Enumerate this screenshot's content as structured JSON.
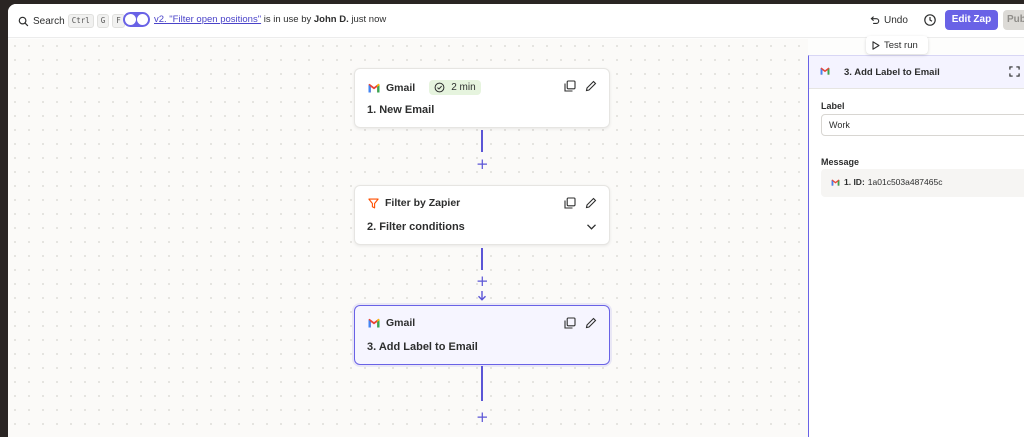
{
  "topbar": {
    "search_label": "Search",
    "shortcut_keys": [
      "Ctrl",
      "G",
      "F"
    ],
    "version_link": "v2. \"Filter open positions\"",
    "notice_middle": " is in use by ",
    "notice_user": "John D.",
    "notice_tail": " just now",
    "undo_label": "Undo",
    "edit_zap_label": "Edit Zap",
    "publish_label": "Pub",
    "test_run_label": "Test run"
  },
  "steps": [
    {
      "app": "Gmail",
      "badge": "2 min",
      "title": "1. New Email"
    },
    {
      "app": "Filter by Zapier",
      "title": "2. Filter conditions"
    },
    {
      "app": "Gmail",
      "title": "3. Add Label to Email"
    }
  ],
  "panel": {
    "title": "3. Add Label to Email",
    "label_heading": "Label",
    "label_value": "Work",
    "message_heading": "Message",
    "message_chip_prefix": "1. ID:",
    "message_chip_value": "1a01c503a487465c"
  },
  "colors": {
    "accent": "#6962e6",
    "connector": "#5b55d6",
    "badge_bg": "#e6f4de"
  }
}
